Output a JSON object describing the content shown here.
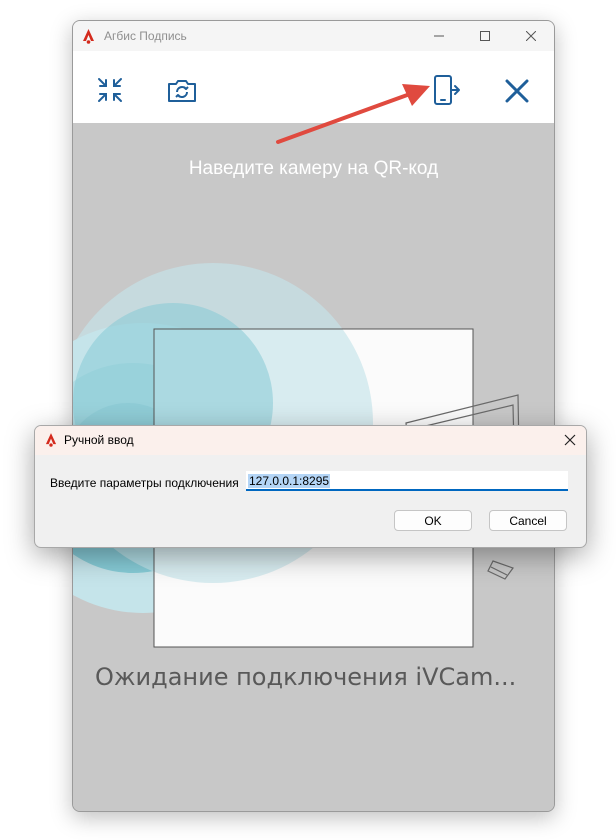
{
  "main_window": {
    "title": "Агбис Подпись",
    "toolbar": {
      "collapse_icon": "collapse-arrows-icon",
      "switch_camera_icon": "switch-camera-icon",
      "phone_connect_icon": "phone-connect-icon",
      "close_icon": "close-icon"
    },
    "instruction": "Наведите камеру на QR-код",
    "status": "Ожидание подключения iVCam..."
  },
  "dialog": {
    "title": "Ручной ввод",
    "field_label": "Введите параметры подключения",
    "field_value": "127.0.0.1:8295",
    "ok_label": "OK",
    "cancel_label": "Cancel"
  },
  "colors": {
    "accent_blue": "#0067c0",
    "toolbar_icon": "#1f5f9a",
    "annotation_arrow": "#e04a3f",
    "viewport_bg": "#c8c8c8"
  }
}
